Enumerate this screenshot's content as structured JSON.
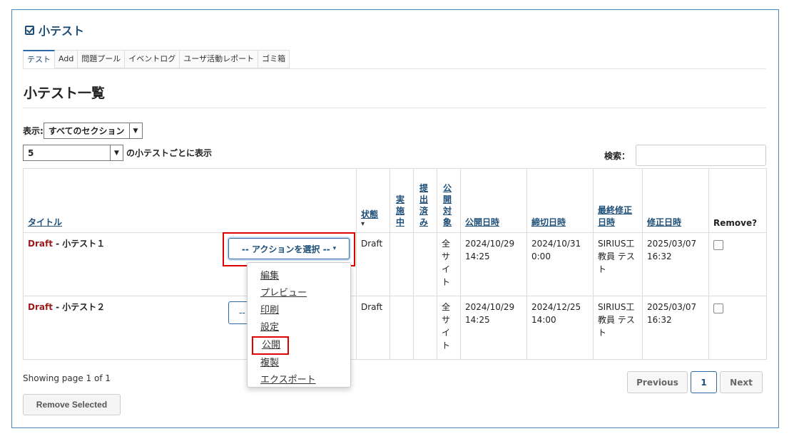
{
  "tool": {
    "title": "小テスト"
  },
  "tabs": [
    "テスト",
    "Add",
    "問題プール",
    "イベントログ",
    "ユーザ活動レポート",
    "ゴミ箱"
  ],
  "page_title": "小テスト一覧",
  "filter": {
    "label": "表示:",
    "value": "すべてのセクション"
  },
  "per_page": {
    "value": "5",
    "suffix": "の小テストごとに表示"
  },
  "search": {
    "label": "検索：",
    "value": ""
  },
  "table": {
    "headers": {
      "title": "タイトル",
      "status": "状態",
      "in_progress": "実施中",
      "submitted": "提出済み",
      "audience": "公開対象",
      "open_date": "公開日時",
      "due_date": "締切日時",
      "last_modified_by": "最終修正日時",
      "modified_date": "修正日時",
      "remove": "Remove?"
    },
    "rows": [
      {
        "draft": "Draft",
        "sep": " - ",
        "name": "小テスト１",
        "status": "Draft",
        "audience": "全サイト",
        "open_date": "2024/10/29 14:25",
        "due_date": "2024/10/31 0:00",
        "modified_by": "SIRIUS工教員 テスト",
        "modified_date": "2025/03/07 16:32"
      },
      {
        "draft": "Draft",
        "sep": " - ",
        "name": "小テスト２",
        "status": "Draft",
        "audience": "全サイト",
        "open_date": "2024/10/29 14:25",
        "due_date": "2024/12/25 14:00",
        "modified_by": "SIRIUS工教員 テスト",
        "modified_date": "2025/03/07 16:32"
      }
    ]
  },
  "action": {
    "label": "-- アクションを選択 --",
    "label_partial": "--"
  },
  "menu": [
    "編集",
    "プレビュー",
    "印刷",
    "設定",
    "公開",
    "複製",
    "エクスポート"
  ],
  "footer": {
    "showing": "Showing page 1 of 1",
    "remove_selected": "Remove Selected",
    "previous": "Previous",
    "page": "1",
    "next": "Next"
  }
}
